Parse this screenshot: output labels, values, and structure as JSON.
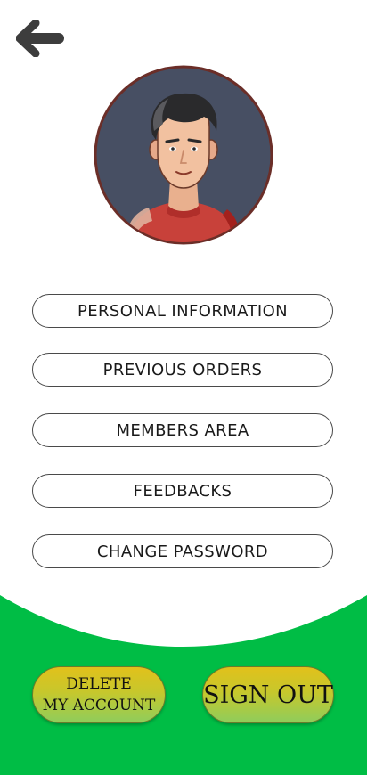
{
  "header": {
    "back_icon": "arrow-left-icon"
  },
  "profile": {
    "avatar_icon": "user-avatar-cartoon"
  },
  "menu": [
    {
      "label": "PERSONAL INFORMATION"
    },
    {
      "label": "PREVIOUS ORDERS"
    },
    {
      "label": "MEMBERS AREA"
    },
    {
      "label": "FEEDBACKS"
    },
    {
      "label": "CHANGE PASSWORD"
    }
  ],
  "actions": {
    "delete_line1": "DELETE",
    "delete_line2": "MY ACCOUNT",
    "signout": "SIGN OUT"
  },
  "colors": {
    "background": "#ffffff",
    "green": "#00bd45",
    "button_gradient_top": "#e1c11b",
    "button_gradient_bottom": "#8fcd5b",
    "icon_dark": "#3d3d3d"
  }
}
